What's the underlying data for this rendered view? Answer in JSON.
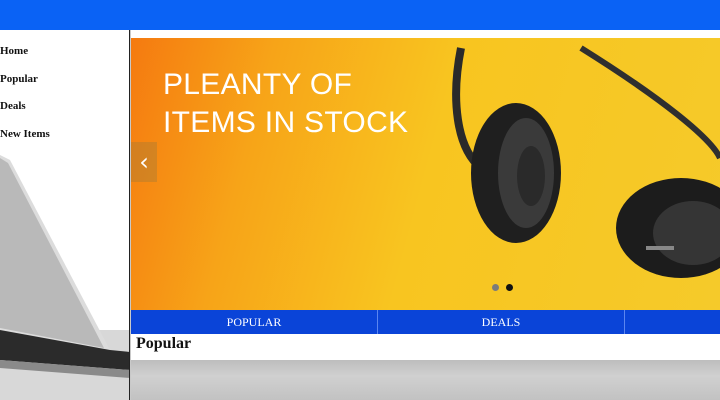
{
  "sidebar": {
    "items": [
      {
        "label": "Home"
      },
      {
        "label": "Popular"
      },
      {
        "label": "Deals"
      },
      {
        "label": "New Items"
      }
    ]
  },
  "carousel": {
    "headline": "PLEANTY OF\nITEMS IN STOCK",
    "prev_icon": "‹",
    "slide_count": 2,
    "active_slide": 2
  },
  "tabs": [
    {
      "label": "POPULAR"
    },
    {
      "label": "DEALS"
    },
    {
      "label": ""
    }
  ],
  "section": {
    "title": "Popular"
  },
  "colors": {
    "topbar": "#0a62f5",
    "tabbar": "#0a44d8",
    "hero_orange": "#f57a10",
    "hero_yellow": "#f8c520"
  }
}
